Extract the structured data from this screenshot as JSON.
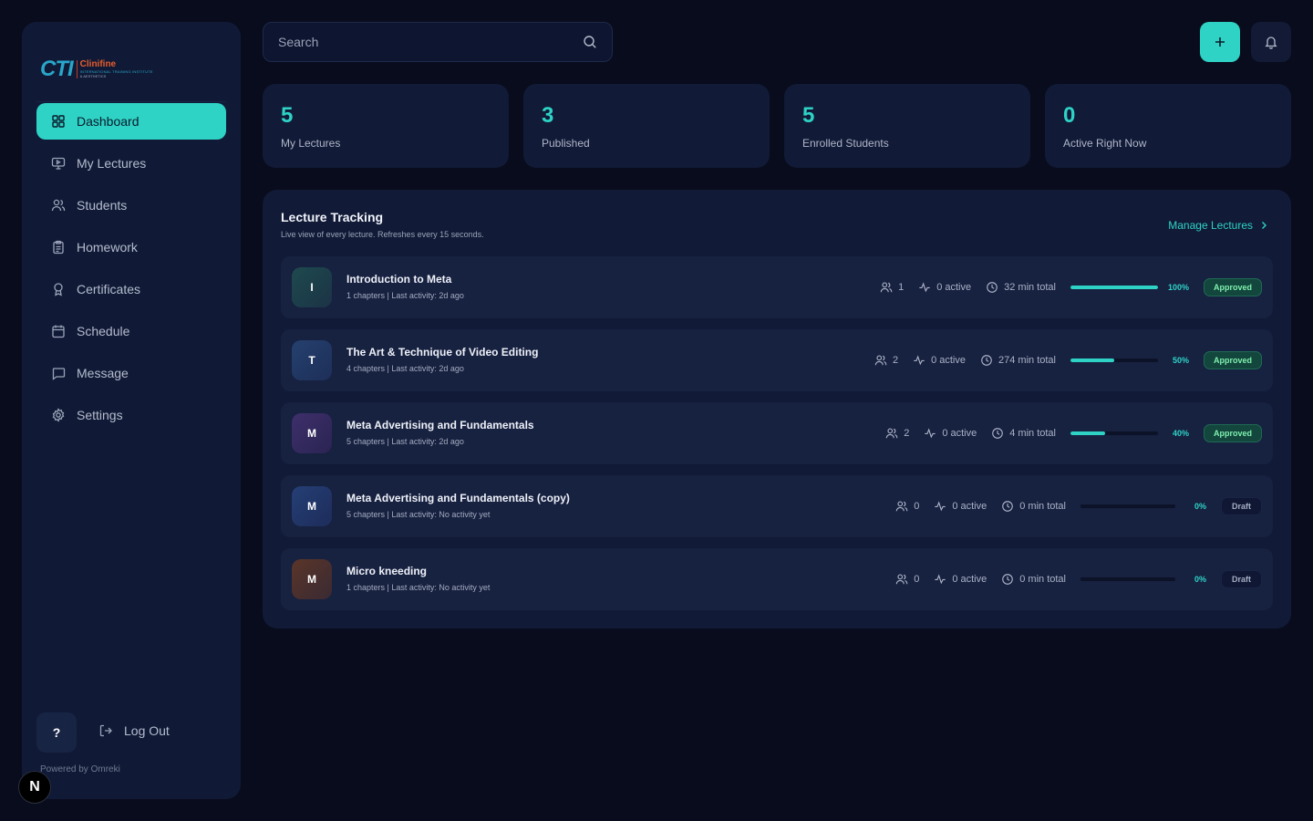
{
  "brand": {
    "mark": "CTI",
    "name": "Clinifine",
    "sub1": "INTERNATIONAL TRAINING INSTITUTE",
    "sub2": "& AESTHETICS"
  },
  "sidebar": {
    "items": [
      {
        "label": "Dashboard",
        "icon": "grid-icon",
        "active": true
      },
      {
        "label": "My Lectures",
        "icon": "presentation-icon",
        "active": false
      },
      {
        "label": "Students",
        "icon": "users-icon",
        "active": false
      },
      {
        "label": "Homework",
        "icon": "clipboard-icon",
        "active": false
      },
      {
        "label": "Certificates",
        "icon": "award-icon",
        "active": false
      },
      {
        "label": "Schedule",
        "icon": "calendar-icon",
        "active": false
      },
      {
        "label": "Message",
        "icon": "message-icon",
        "active": false
      },
      {
        "label": "Settings",
        "icon": "gear-icon",
        "active": false
      }
    ],
    "help_label": "?",
    "logout_label": "Log Out",
    "powered_by": "Powered by Omreki",
    "n_badge": "N"
  },
  "header": {
    "search_placeholder": "Search"
  },
  "stats": [
    {
      "value": "5",
      "label": "My Lectures"
    },
    {
      "value": "3",
      "label": "Published"
    },
    {
      "value": "5",
      "label": "Enrolled Students"
    },
    {
      "value": "0",
      "label": "Active Right Now"
    }
  ],
  "tracking": {
    "title": "Lecture Tracking",
    "subtitle": "Live view of every lecture. Refreshes every 15 seconds.",
    "manage_label": "Manage Lectures",
    "rows": [
      {
        "initial": "I",
        "title": "Introduction to Meta",
        "meta": "1 chapters | Last activity: 2d ago",
        "students": "1",
        "active": "0 active",
        "total": "32 min total",
        "progress": 100,
        "pct": "100%",
        "status": "Approved",
        "avatar_from": "#1e4a4e",
        "avatar_to": "#1b3346"
      },
      {
        "initial": "T",
        "title": "The Art & Technique of Video Editing",
        "meta": "4 chapters | Last activity: 2d ago",
        "students": "2",
        "active": "0 active",
        "total": "274 min total",
        "progress": 50,
        "pct": "50%",
        "status": "Approved",
        "avatar_from": "#25406e",
        "avatar_to": "#1d2f59"
      },
      {
        "initial": "M",
        "title": "Meta Advertising and Fundamentals",
        "meta": "5 chapters | Last activity: 2d ago",
        "students": "2",
        "active": "0 active",
        "total": "4 min total",
        "progress": 40,
        "pct": "40%",
        "status": "Approved",
        "avatar_from": "#3e2f6b",
        "avatar_to": "#2a2452"
      },
      {
        "initial": "M",
        "title": "Meta Advertising and Fundamentals (copy)",
        "meta": "5 chapters | Last activity: No activity yet",
        "students": "0",
        "active": "0 active",
        "total": "0 min total",
        "progress": 0,
        "pct": "0%",
        "status": "Draft",
        "avatar_from": "#253f75",
        "avatar_to": "#1d2c5a"
      },
      {
        "initial": "M",
        "title": "Micro kneeding",
        "meta": "1 chapters | Last activity: No activity yet",
        "students": "0",
        "active": "0 active",
        "total": "0 min total",
        "progress": 0,
        "pct": "0%",
        "status": "Draft",
        "avatar_from": "#5a3528",
        "avatar_to": "#3a2a33"
      }
    ]
  },
  "colors": {
    "accent": "#2ed3c6",
    "background": "#090c1c",
    "panel": "#111a36"
  }
}
